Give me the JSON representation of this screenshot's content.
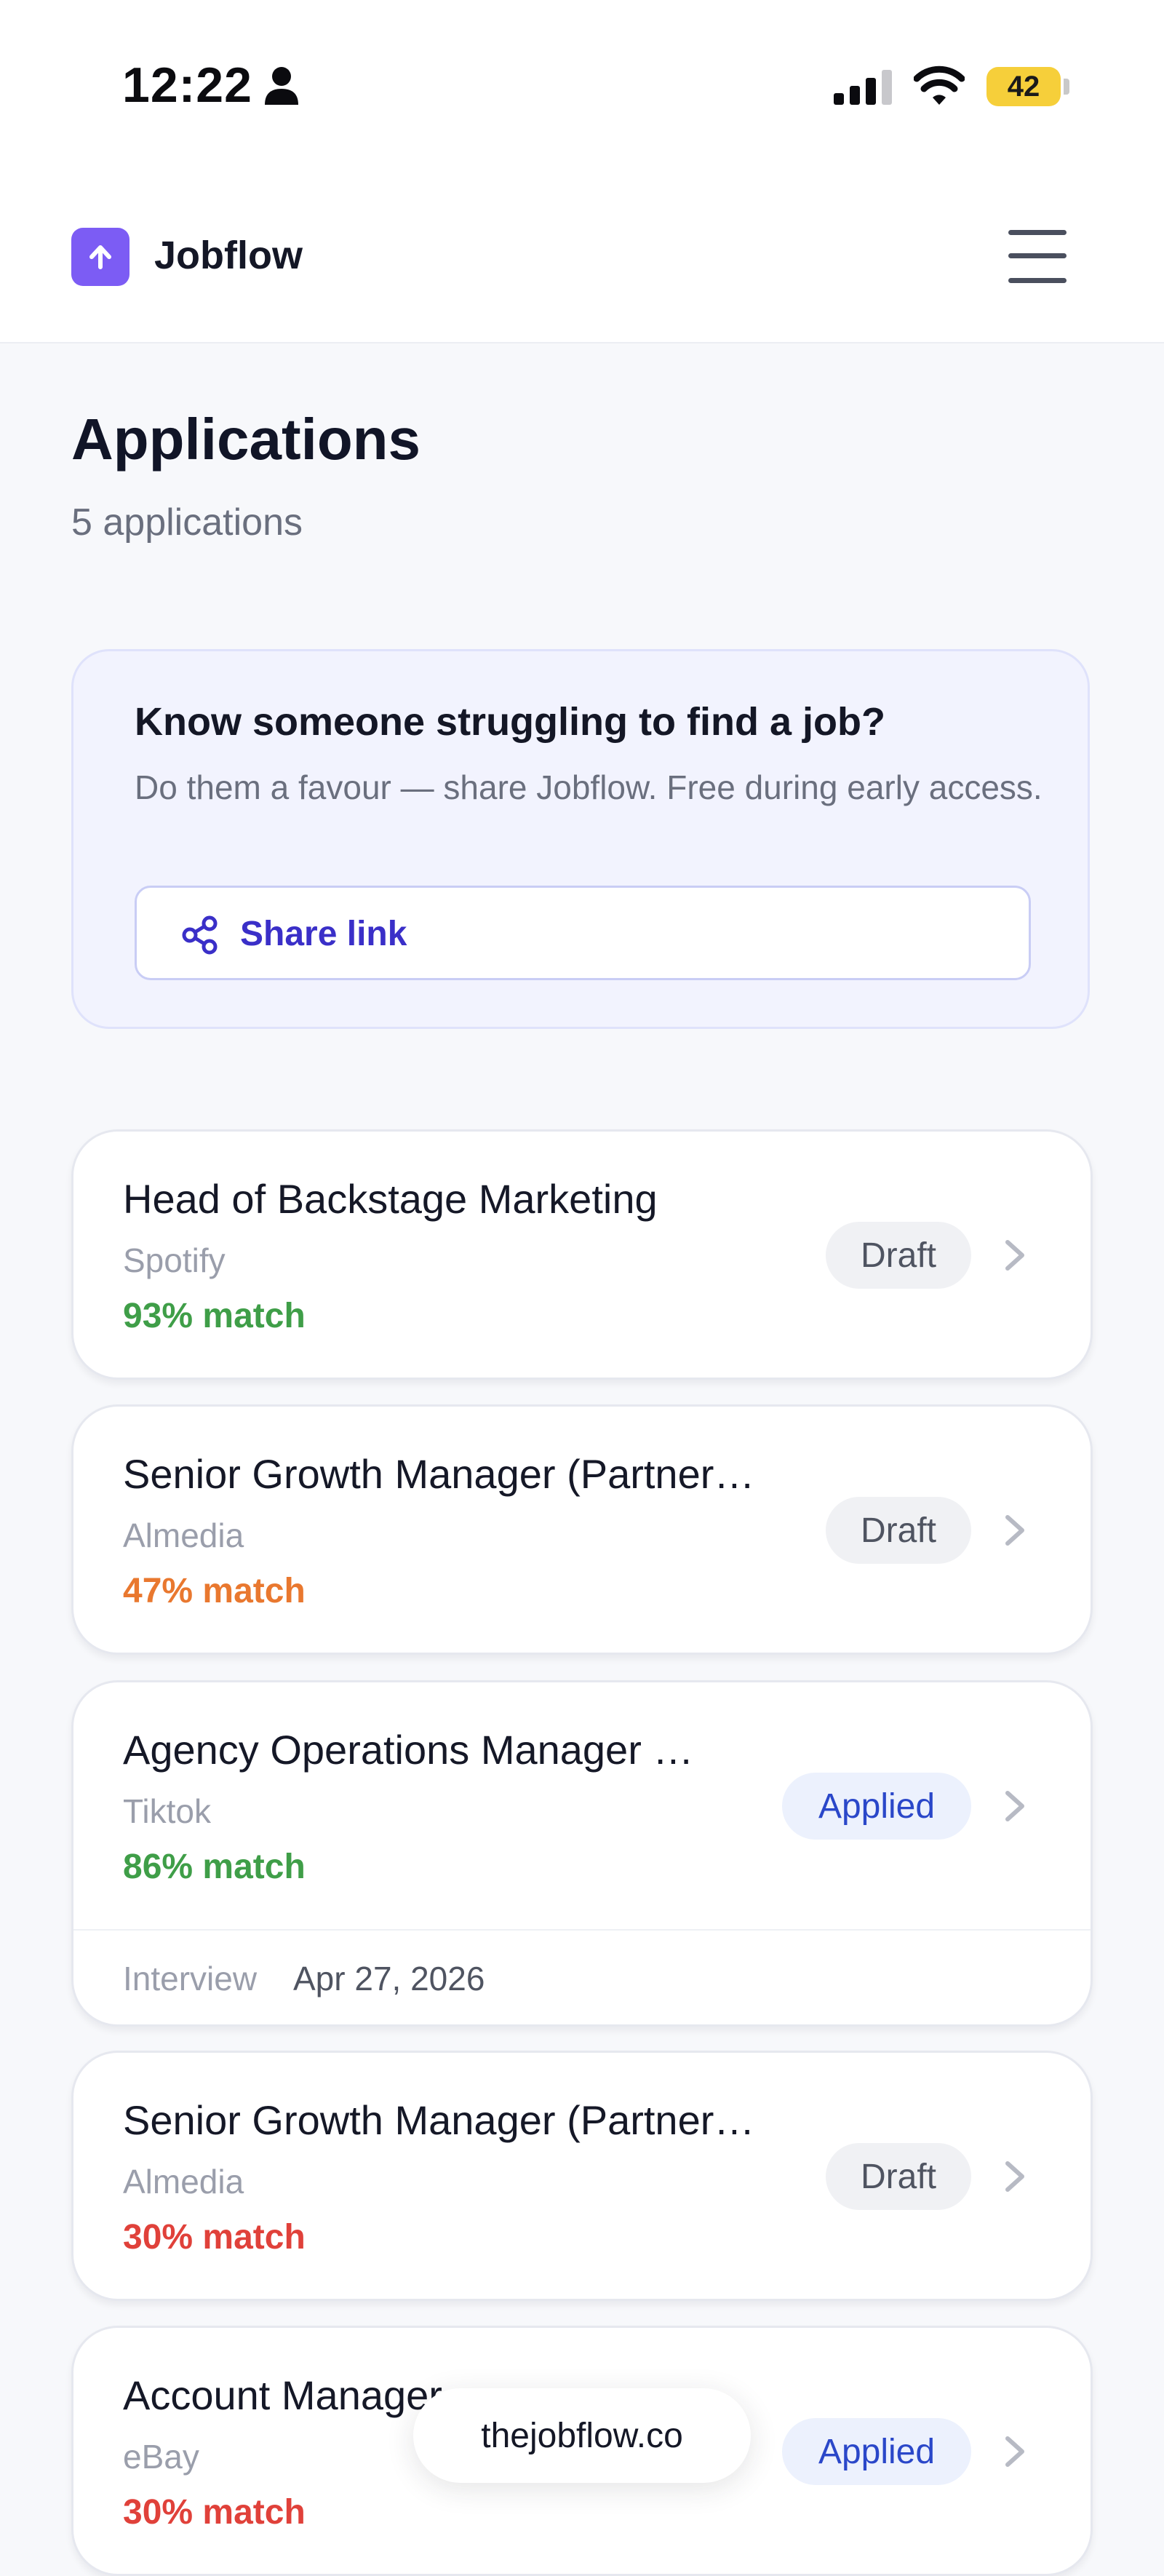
{
  "status_bar": {
    "time": "12:22",
    "battery": "42"
  },
  "header": {
    "brand": "Jobflow"
  },
  "page": {
    "title": "Applications",
    "subtitle": "5 applications"
  },
  "share_card": {
    "title": "Know someone struggling to find a job?",
    "text": "Do them a favour — share Jobflow. Free during early access.",
    "button_label": "Share link"
  },
  "applications": [
    {
      "title": "Head of Backstage Marketing",
      "company": "Spotify",
      "match": "93% match",
      "match_color": "#3f9e48",
      "status": "Draft"
    },
    {
      "title": "Senior Growth Manager (Partner…",
      "company": "Almedia",
      "match": "47% match",
      "match_color": "#e9782f",
      "status": "Draft"
    },
    {
      "title": "Agency Operations Manager …",
      "company": "Tiktok",
      "match": "86% match",
      "match_color": "#3f9e48",
      "status": "Applied",
      "interview_label": "Interview",
      "interview_date": "Apr 27, 2026"
    },
    {
      "title": "Senior Growth Manager (Partner…",
      "company": "Almedia",
      "match": "30% match",
      "match_color": "#e0413a",
      "status": "Draft"
    },
    {
      "title": "Account Manager",
      "company": "eBay",
      "match": "30% match",
      "match_color": "#e0413a",
      "status": "Applied"
    }
  ],
  "domain": "thejobflow.co",
  "colors": {
    "accent": "#7c5cf4",
    "link": "#3a2fc8"
  }
}
